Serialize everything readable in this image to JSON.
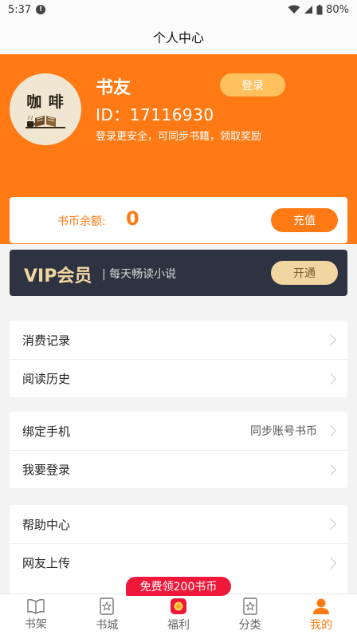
{
  "status_bar": {
    "time": "5:37",
    "battery": "80%"
  },
  "page_title": "个人中心",
  "profile": {
    "avatar_text": "咖 啡",
    "name": "书友",
    "login_label": "登录",
    "id_text": "ID：17116930",
    "login_tip": "登录更安全，可同步书籍，领取奖励"
  },
  "coins": {
    "label": "书币余额:",
    "value": "0",
    "recharge_label": "充值"
  },
  "vip": {
    "title": "VIP会员",
    "subtitle": "| 每天畅读小说",
    "open_label": "开通"
  },
  "menu_groups": [
    [
      {
        "label": "消费记录"
      },
      {
        "label": "阅读历史"
      }
    ],
    [
      {
        "label": "绑定手机",
        "extra": "同步账号书币"
      },
      {
        "label": "我要登录"
      }
    ],
    [
      {
        "label": "帮助中心"
      },
      {
        "label": "网友上传"
      }
    ]
  ],
  "promo_badge": "免费领200书币",
  "tabs": [
    {
      "label": "书架",
      "icon": "book-open-icon"
    },
    {
      "label": "书城",
      "icon": "star-book-icon"
    },
    {
      "label": "福利",
      "icon": "gift-icon"
    },
    {
      "label": "分类",
      "icon": "star-book-icon"
    },
    {
      "label": "我的",
      "icon": "user-icon",
      "active": true
    }
  ],
  "colors": {
    "accent": "#ff7a14",
    "vip_bg": "#2e3342",
    "vip_gold": "#f2d6a2",
    "promo_red": "#f0183a"
  }
}
